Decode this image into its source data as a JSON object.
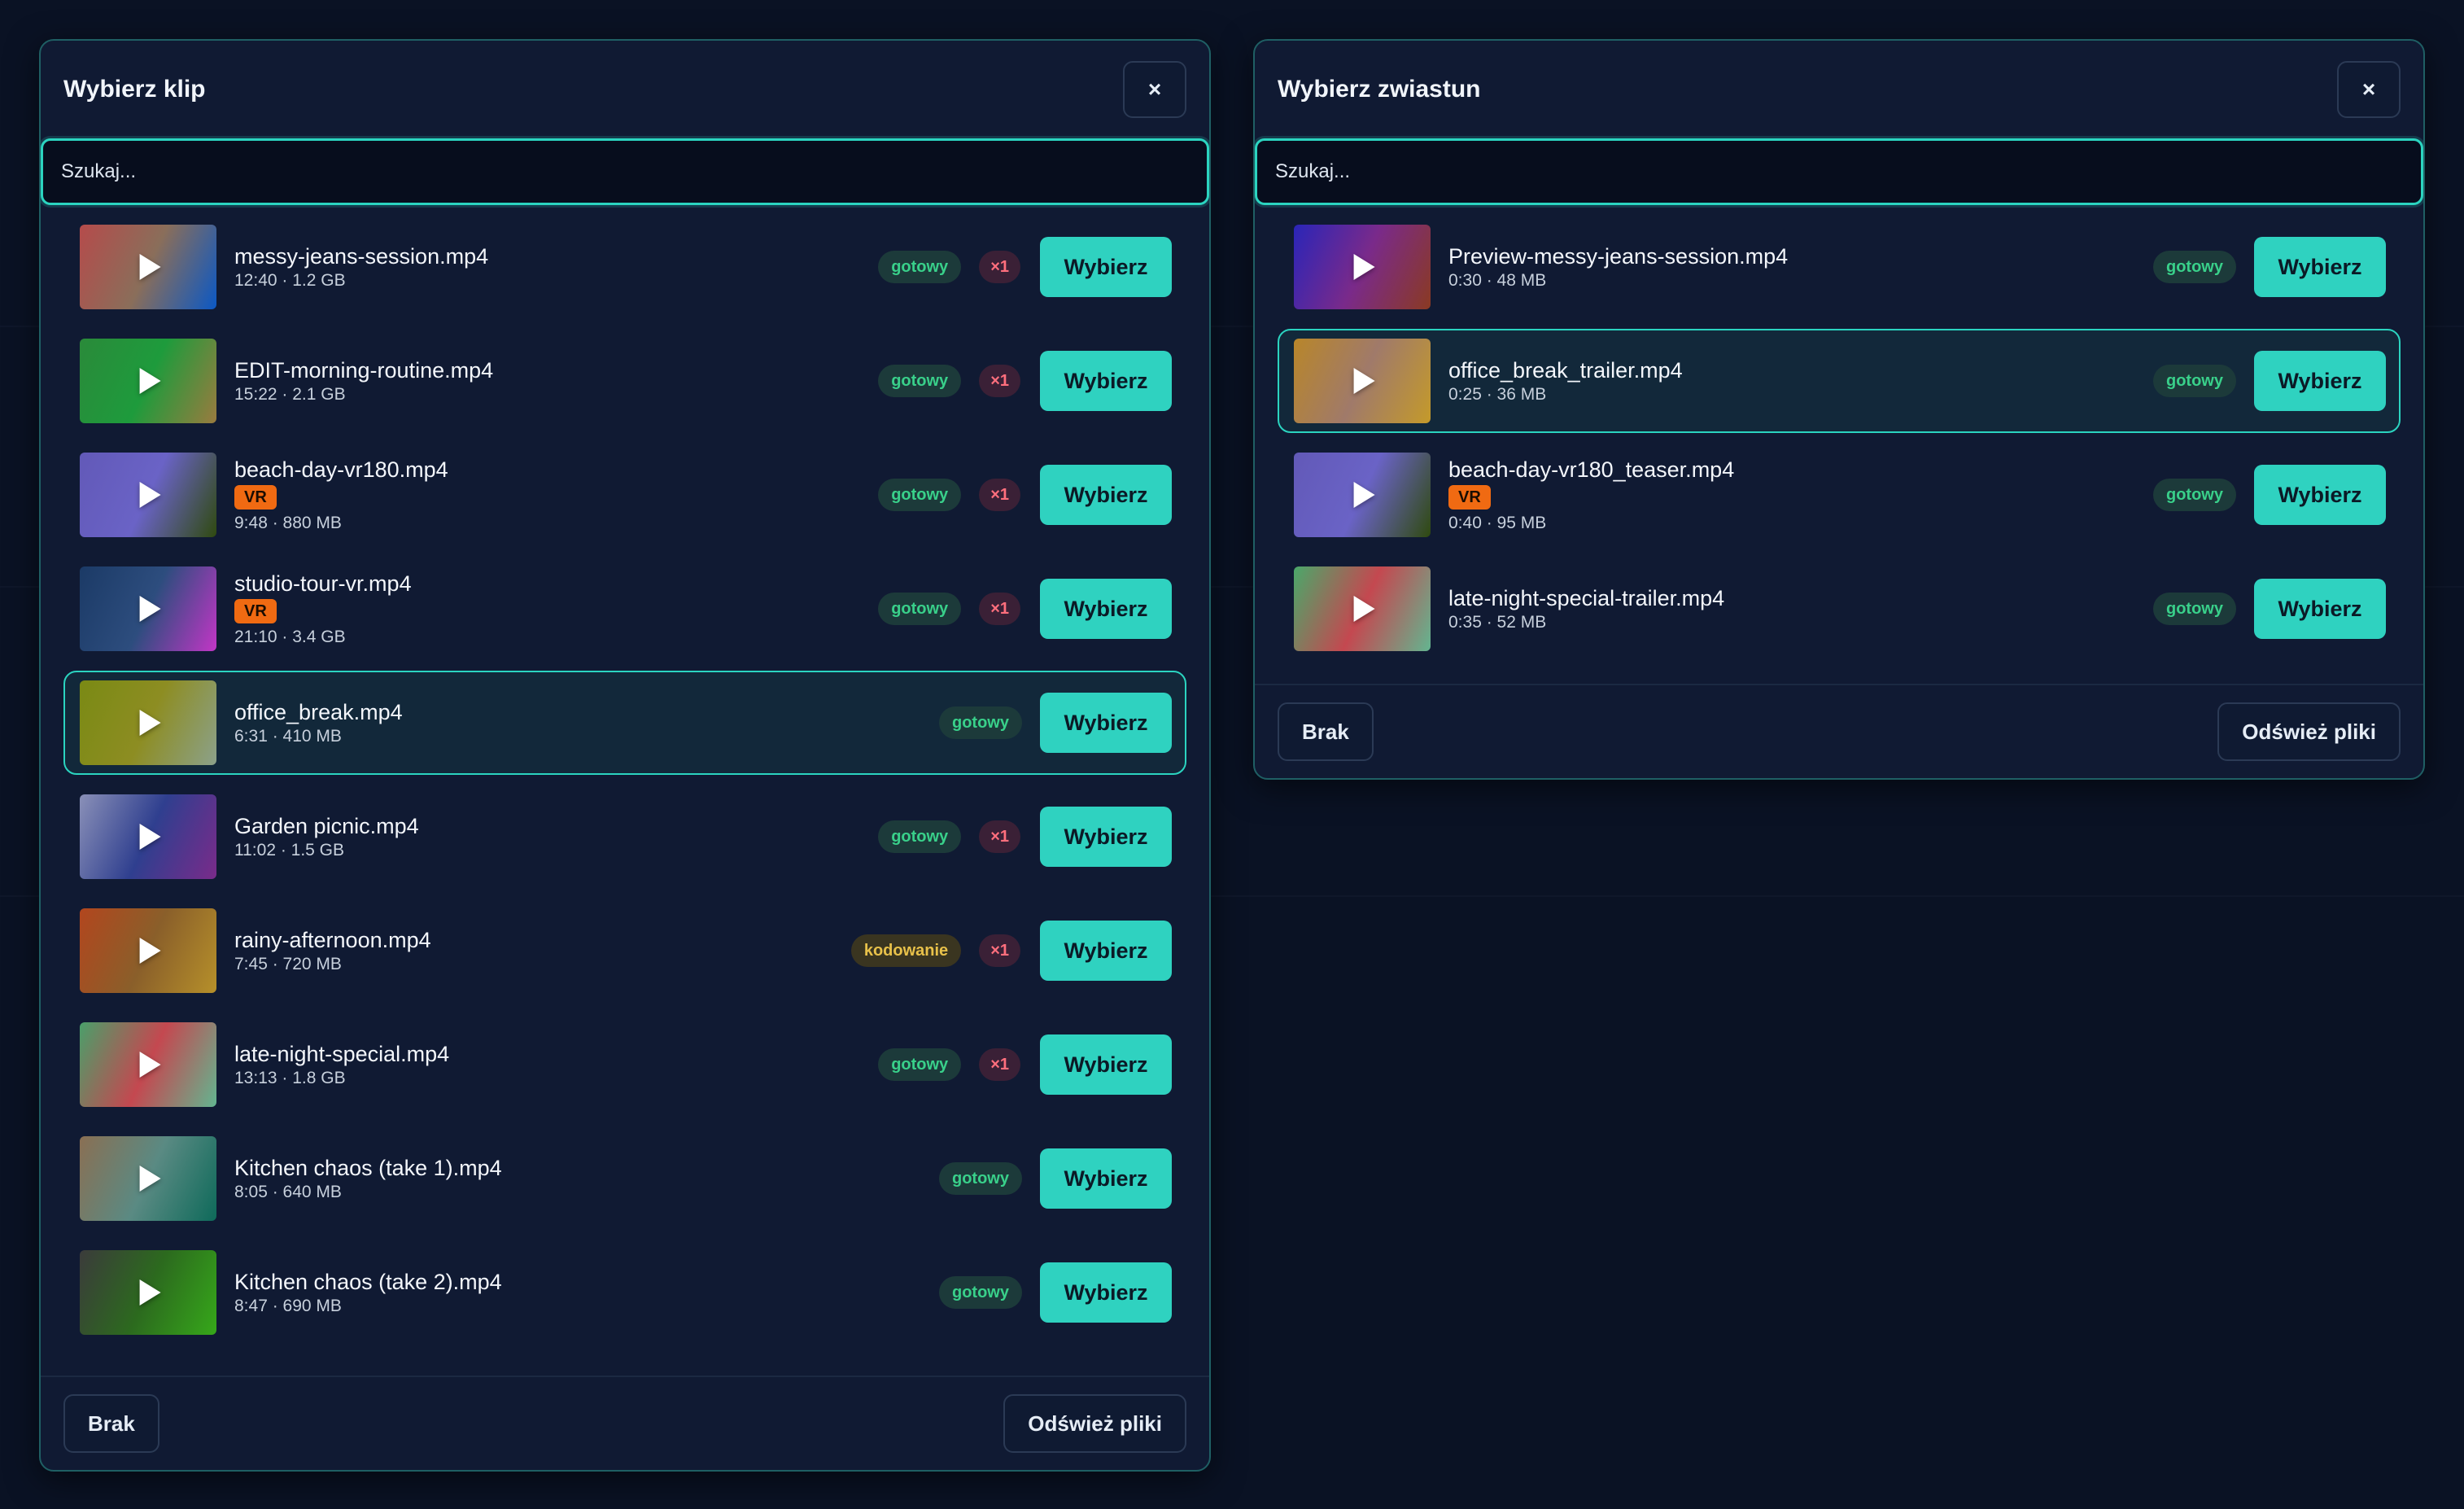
{
  "clip_panel": {
    "title": "Wybierz klip",
    "close_label": "×",
    "search_placeholder": "Szukaj...",
    "none_label": "Brak",
    "refresh_label": "Odśwież pliki",
    "pick_label": "Wybierz",
    "items": [
      {
        "name": "messy-jeans-session.mp4",
        "meta": "12:40 · 1.2 GB",
        "vr": "",
        "status": "gotowy",
        "status_type": "ok",
        "count": "×1",
        "selected": false,
        "thumb": [
          "#b54b4b",
          "#8a6e5a",
          "#0b58c4"
        ]
      },
      {
        "name": "EDIT-morning-routine.mp4",
        "meta": "15:22 · 2.1 GB",
        "vr": "",
        "status": "gotowy",
        "status_type": "ok",
        "count": "×1",
        "selected": false,
        "thumb": [
          "#2a8a3a",
          "#1e9b3c",
          "#9a7b3f"
        ]
      },
      {
        "name": "beach-day-vr180.mp4",
        "meta": "9:48 · 880 MB",
        "vr": "VR",
        "status": "gotowy",
        "status_type": "ok",
        "count": "×1",
        "selected": false,
        "thumb": [
          "#6259b8",
          "#6a63c6",
          "#2f4a0f"
        ]
      },
      {
        "name": "studio-tour-vr.mp4",
        "meta": "21:10 · 3.4 GB",
        "vr": "VR",
        "status": "gotowy",
        "status_type": "ok",
        "count": "×1",
        "selected": false,
        "thumb": [
          "#1b3a66",
          "#2d4d7e",
          "#c236c6"
        ]
      },
      {
        "name": "office_break.mp4",
        "meta": "6:31 · 410 MB",
        "vr": "",
        "status": "gotowy",
        "status_type": "ok",
        "count": "",
        "selected": true,
        "thumb": [
          "#7a8a14",
          "#8d8d22",
          "#8ca18a"
        ]
      },
      {
        "name": "Garden picnic.mp4",
        "meta": "11:02 · 1.5 GB",
        "vr": "",
        "status": "gotowy",
        "status_type": "ok",
        "count": "×1",
        "selected": false,
        "thumb": [
          "#8a90b8",
          "#2f3f8f",
          "#7a2b8a"
        ]
      },
      {
        "name": "rainy-afternoon.mp4",
        "meta": "7:45 · 720 MB",
        "vr": "",
        "status": "kodowanie",
        "status_type": "enc",
        "count": "×1",
        "selected": false,
        "thumb": [
          "#b2461e",
          "#8a5f2a",
          "#b6902a"
        ]
      },
      {
        "name": "late-night-special.mp4",
        "meta": "13:13 · 1.8 GB",
        "vr": "",
        "status": "gotowy",
        "status_type": "ok",
        "count": "×1",
        "selected": false,
        "thumb": [
          "#4a9f6a",
          "#c44850",
          "#63b590"
        ]
      },
      {
        "name": "Kitchen chaos (take 1).mp4",
        "meta": "8:05 · 640 MB",
        "vr": "",
        "status": "gotowy",
        "status_type": "ok",
        "count": "",
        "selected": false,
        "thumb": [
          "#8a6f53",
          "#5a8a83",
          "#0e6a5a"
        ]
      },
      {
        "name": "Kitchen chaos (take 2).mp4",
        "meta": "8:47 · 690 MB",
        "vr": "",
        "status": "gotowy",
        "status_type": "ok",
        "count": "",
        "selected": false,
        "thumb": [
          "#3b3b3b",
          "#2c6a1e",
          "#36a81a"
        ]
      }
    ]
  },
  "trailer_panel": {
    "title": "Wybierz zwiastun",
    "close_label": "×",
    "search_placeholder": "Szukaj...",
    "none_label": "Brak",
    "refresh_label": "Odśwież pliki",
    "pick_label": "Wybierz",
    "items": [
      {
        "name": "Preview-messy-jeans-session.mp4",
        "meta": "0:30 · 48 MB",
        "vr": "",
        "status": "gotowy",
        "status_type": "ok",
        "count": "",
        "selected": false,
        "thumb": [
          "#2a25b8",
          "#7a2a8a",
          "#8a3a22"
        ]
      },
      {
        "name": "office_break_trailer.mp4",
        "meta": "0:25 · 36 MB",
        "vr": "",
        "status": "gotowy",
        "status_type": "ok",
        "count": "",
        "selected": true,
        "thumb": [
          "#b8862a",
          "#a07a6a",
          "#c49a2a"
        ]
      },
      {
        "name": "beach-day-vr180_teaser.mp4",
        "meta": "0:40 · 95 MB",
        "vr": "VR",
        "status": "gotowy",
        "status_type": "ok",
        "count": "",
        "selected": false,
        "thumb": [
          "#6259b8",
          "#6a63c6",
          "#2f4a0f"
        ]
      },
      {
        "name": "late-night-special-trailer.mp4",
        "meta": "0:35 · 52 MB",
        "vr": "",
        "status": "gotowy",
        "status_type": "ok",
        "count": "",
        "selected": false,
        "thumb": [
          "#4aa86a",
          "#c44850",
          "#63b590"
        ]
      }
    ]
  }
}
